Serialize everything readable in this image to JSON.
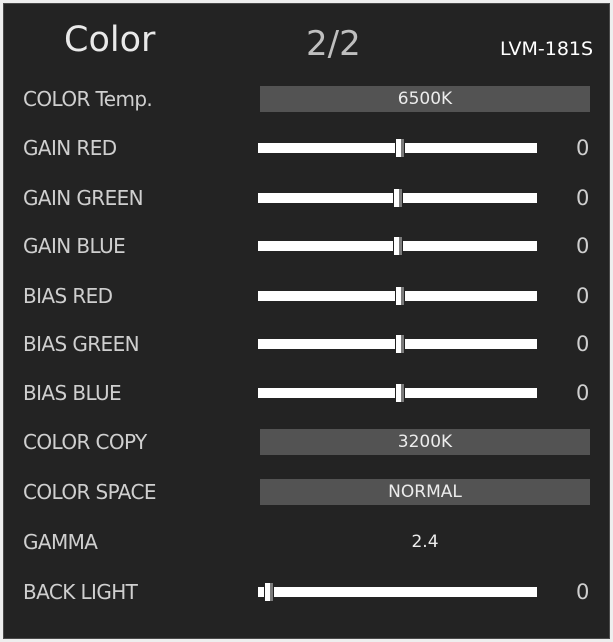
{
  "header": {
    "title": "Color",
    "page": "2/2",
    "model": "LVM-181S"
  },
  "menu": {
    "color_temp": {
      "label": "COLOR Temp.",
      "value": "6500K"
    },
    "gain_red": {
      "label": "GAIN RED",
      "level": 0.51,
      "value": "0"
    },
    "gain_green": {
      "label": "GAIN GREEN",
      "level": 0.5,
      "value": "0"
    },
    "gain_blue": {
      "label": "GAIN BLUE",
      "level": 0.5,
      "value": "0"
    },
    "bias_red": {
      "label": "BIAS RED",
      "level": 0.51,
      "value": "0"
    },
    "bias_green": {
      "label": "BIAS GREEN",
      "level": 0.51,
      "value": "0"
    },
    "bias_blue": {
      "label": "BIAS BLUE",
      "level": 0.51,
      "value": "0"
    },
    "color_copy": {
      "label": "COLOR COPY",
      "value": "3200K"
    },
    "color_space": {
      "label": "COLOR SPACE",
      "value": "NORMAL"
    },
    "gamma": {
      "label": "GAMMA",
      "value": "2.4"
    },
    "back_light": {
      "label": "BACK LIGHT",
      "level": 0.04,
      "value": "0"
    }
  }
}
